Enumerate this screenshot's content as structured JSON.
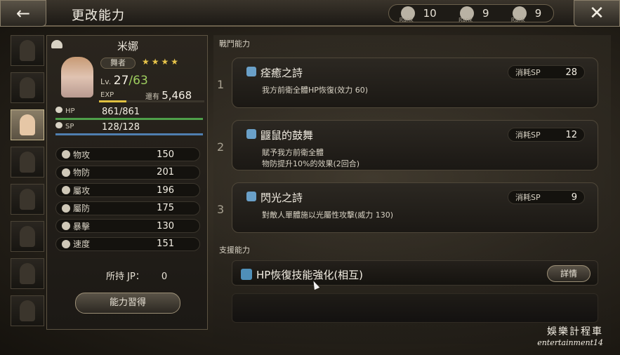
{
  "header": {
    "title": "更改能力",
    "back_icon": "←",
    "close_icon": "✕",
    "ranks": [
      {
        "icon": "rank-emblem-1",
        "value": "10"
      },
      {
        "icon": "rank-emblem-2",
        "value": "9"
      },
      {
        "icon": "rank-emblem-3",
        "value": "9"
      }
    ]
  },
  "character": {
    "name": "米娜",
    "job": "舞者",
    "stars": "★★★★",
    "lv_label": "Lv.",
    "level": "27",
    "max_level": "/63",
    "exp_label": "EXP",
    "next_label": "還有",
    "next_value": "5,468",
    "exp_fraction": 0.26,
    "hp_label": "HP",
    "hp": "861/861",
    "sp_label": "SP",
    "sp": "128/128",
    "stats": [
      {
        "label": "物攻",
        "value": "150"
      },
      {
        "label": "物防",
        "value": "201"
      },
      {
        "label": "屬攻",
        "value": "196"
      },
      {
        "label": "屬防",
        "value": "175"
      },
      {
        "label": "暴擊",
        "value": "130"
      },
      {
        "label": "速度",
        "value": "151"
      }
    ],
    "jp_label": "所持 JP：",
    "jp_value": "0",
    "learn_label": "能力習得"
  },
  "party_portraits": [
    {
      "active": false
    },
    {
      "active": false
    },
    {
      "active": true
    },
    {
      "active": false
    },
    {
      "active": false
    },
    {
      "active": false
    },
    {
      "active": false
    },
    {
      "active": false
    }
  ],
  "battle": {
    "section_label": "戰鬥能力",
    "skills": [
      {
        "num": "1",
        "name": "痊癒之詩",
        "desc1": "我方前衛全體HP恢復(效力 60)",
        "desc2": "",
        "sp_label": "消耗SP",
        "sp": "28"
      },
      {
        "num": "2",
        "name": "鼴鼠的鼓舞",
        "desc1": "賦予我方前衛全體",
        "desc2": "物防提升10%的效果(2回合)",
        "sp_label": "消耗SP",
        "sp": "12"
      },
      {
        "num": "3",
        "name": "閃光之詩",
        "desc1": "對敵人單體施以光屬性攻擊(威力 130)",
        "desc2": "",
        "sp_label": "消耗SP",
        "sp": "9"
      }
    ]
  },
  "support": {
    "section_label": "支援能力",
    "name": "HP恢復技能強化(相互)",
    "detail_label": "詳情"
  },
  "watermark": {
    "line1": "娛樂計程車",
    "line2": "entertainment14"
  }
}
